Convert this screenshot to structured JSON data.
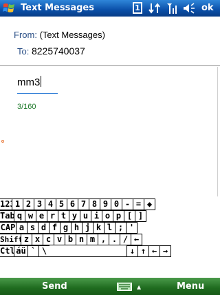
{
  "title_bar": {
    "title": "Text Messages",
    "status": {
      "sim_label": "1",
      "trailing": "ok",
      "icons": [
        "windows-flag-icon",
        "connectivity-icon",
        "signal-icon",
        "volume-icon"
      ]
    }
  },
  "header": {
    "from_label": "From:",
    "from_value": "(Text Messages)",
    "to_label": "To:",
    "to_value": "8225740037"
  },
  "message": {
    "body": "mm3",
    "counter": "3/160"
  },
  "keyboard": {
    "rows": [
      [
        "123",
        "1",
        "2",
        "3",
        "4",
        "5",
        "6",
        "7",
        "8",
        "9",
        "0",
        "-",
        "=",
        "◆"
      ],
      [
        "Tab",
        "q",
        "w",
        "e",
        "r",
        "t",
        "y",
        "u",
        "i",
        "o",
        "p",
        "[",
        "]"
      ],
      [
        "CAP",
        "a",
        "s",
        "d",
        "f",
        "g",
        "h",
        "j",
        "k",
        "l",
        ";",
        "'"
      ],
      [
        "Shift",
        "z",
        "x",
        "c",
        "v",
        "b",
        "n",
        "m",
        ",",
        ".",
        "/",
        "←"
      ],
      [
        "Ctl",
        "áü",
        "`",
        "\\",
        "",
        "↓",
        "↑",
        "←",
        "→"
      ]
    ]
  },
  "soft_keys": {
    "left": "Send",
    "right": "Menu",
    "center_caret": "▲"
  },
  "colors": {
    "title_bar": "#0b4fa8",
    "soft_bar": "#1f6b1f",
    "label_blue": "#2a4f86",
    "counter_green": "#1e7a2a",
    "underline_blue": "#2c7bd6"
  }
}
